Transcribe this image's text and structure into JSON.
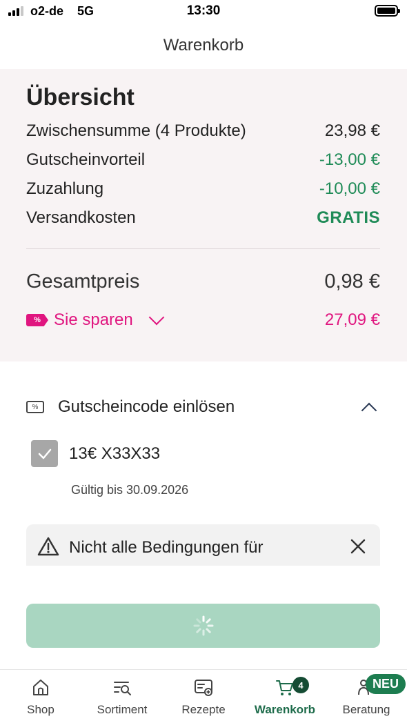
{
  "status_bar": {
    "carrier": "o2-de",
    "network": "5G",
    "time": "13:30"
  },
  "header": {
    "title": "Warenkorb"
  },
  "overview": {
    "title": "Übersicht",
    "rows": [
      {
        "label": "Zwischensumme (4 Produkte)",
        "value": "23,98 €"
      },
      {
        "label": "Gutscheinvorteil",
        "value": "-13,00 €"
      },
      {
        "label": "Zuzahlung",
        "value": "-10,00 €"
      },
      {
        "label": "Versandkosten",
        "value": "GRATIS"
      }
    ],
    "total_label": "Gesamtpreis",
    "total_value": "0,98 €",
    "savings_tag": "%",
    "savings_label": "Sie sparen",
    "savings_value": "27,09 €"
  },
  "coupon": {
    "header": "Gutscheincode einlösen",
    "code": "13€ X33X33",
    "valid": "Gültig bis 30.09.2026",
    "ticket_symbol": "%"
  },
  "warning": {
    "text": "Nicht alle Bedingungen für"
  },
  "colors": {
    "green": "#1f8b57",
    "pink": "#e0157f",
    "button": "#a9d6c1",
    "active_tab": "#1d6b4a"
  },
  "tabs": [
    {
      "label": "Shop",
      "icon": "home-icon"
    },
    {
      "label": "Sortiment",
      "icon": "catalog-search-icon"
    },
    {
      "label": "Rezepte",
      "icon": "prescription-icon"
    },
    {
      "label": "Warenkorb",
      "icon": "cart-icon",
      "badge": "4"
    },
    {
      "label": "Beratung",
      "icon": "consultation-icon",
      "badge": "NEU"
    }
  ]
}
